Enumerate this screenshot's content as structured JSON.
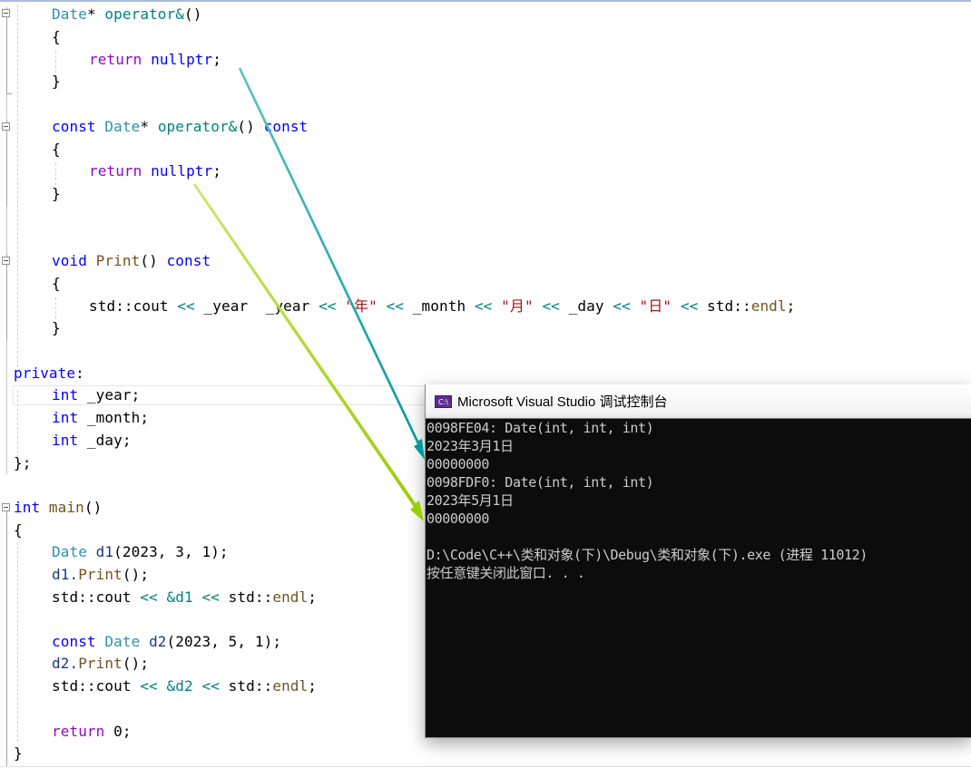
{
  "editor": {
    "lines": {
      "l1": {
        "type": "Date",
        "star": "* ",
        "op": "operator&",
        "paren": "()"
      },
      "l2": "{",
      "l3": {
        "ret": "return",
        "nul": "nullptr",
        "semi": ";"
      },
      "l4": "}",
      "l6": {
        "kw": "const",
        "type": "Date",
        "star": "* ",
        "op": "operator&",
        "paren": "()",
        "kw2": "const"
      },
      "l7": "{",
      "l8": {
        "ret": "return",
        "nul": "nullptr",
        "semi": ";"
      },
      "l9": "}",
      "l12": {
        "kw": "void",
        "fn": "Print",
        "paren": "()",
        "kw2": "const"
      },
      "l13": "{",
      "l14": {
        "a": "std::cout ",
        "op1": "<<",
        " b": " _year ",
        "op2": "<<",
        "s1": "\"年\"",
        "op3": "<<",
        "c": " _month ",
        "op4": "<<",
        "s2": "\"月\"",
        "op5": "<<",
        "d": " _day ",
        "op6": "<<",
        "s3": "\"日\"",
        "op7": "<<",
        "e": " std::",
        "endl": "endl",
        "semi": ";"
      },
      "l15": "}",
      "l17": {
        "kw": "private",
        ":": ":"
      },
      "l18": {
        "kw": "int",
        "rest": " _year;"
      },
      "l19": {
        "kw": "int",
        "rest": " _month;"
      },
      "l20": {
        "kw": "int",
        "rest": " _day;"
      },
      "l21": "};",
      "l23": {
        "kw": "int",
        "fn": " main",
        "paren": "()"
      },
      "l24": "{",
      "l25": {
        "type": "Date",
        "v": " d1",
        "args": "(2023, 3, 1);"
      },
      "l26": {
        "v": "d1.",
        "fn": "Print",
        "rest": "();"
      },
      "l27": {
        "a": "std::cout ",
        "op1": "<<",
        "b": " ",
        "op2": "&d1",
        "c": " ",
        "op3": "<<",
        "d": " std::",
        "endl": "endl",
        "semi": ";"
      },
      "l29": {
        "kw": "const",
        "type": " Date",
        "v": " d2",
        "args": "(2023, 5, 1);"
      },
      "l30": {
        "v": "d2.",
        "fn": "Print",
        "rest": "();"
      },
      "l31": {
        "a": "std::cout ",
        "op1": "<<",
        "b": " ",
        "op2": "&d2",
        "c": " ",
        "op3": "<<",
        "d": " std::",
        "endl": "endl",
        "semi": ";"
      },
      "l33": {
        "ret": "return",
        "rest": " 0;"
      },
      "l34": "}"
    }
  },
  "console": {
    "icon_text": "C:\\",
    "title": "Microsoft Visual Studio 调试控制台",
    "lines": [
      "0098FE04: Date(int, int, int)",
      "2023年3月1日",
      "00000000",
      "0098FDF0: Date(int, int, int)",
      "2023年5月1日",
      "00000000",
      "",
      "D:\\Code\\C++\\类和对象(下)\\Debug\\类和对象(下).exe (进程 11012)",
      "按任意键关闭此窗口. . ."
    ]
  },
  "annotations": {
    "arrow_colors": {
      "teal": "#00979a",
      "green": "#99cc00"
    }
  }
}
